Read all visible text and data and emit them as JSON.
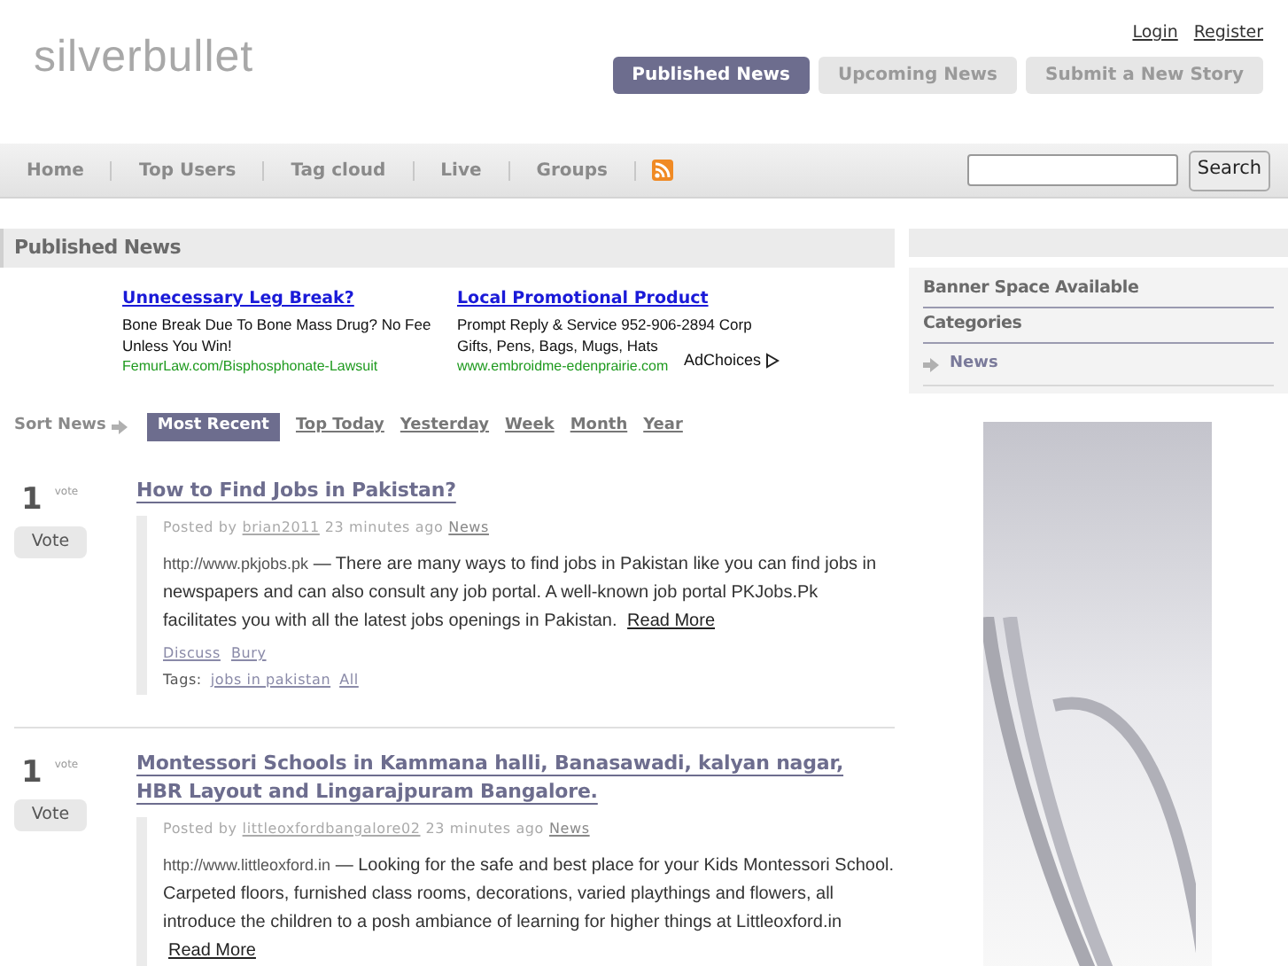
{
  "logo": "silverbullet",
  "user_links": [
    "Login",
    "Register"
  ],
  "tabs": [
    {
      "label": "Published News",
      "selected": true
    },
    {
      "label": "Upcoming News",
      "selected": false
    },
    {
      "label": "Submit a New Story",
      "selected": false
    }
  ],
  "nav": {
    "items": [
      "Home",
      "Top Users",
      "Tag cloud",
      "Live",
      "Groups"
    ],
    "search_button": "Search"
  },
  "main": {
    "title": "Published News",
    "ads": [
      {
        "title": "Unnecessary Leg Break?",
        "body": "Bone Break Due To Bone Mass Drug? No Fee Unless You Win!",
        "url": "FemurLaw.com/Bisphosphonate-Lawsuit"
      },
      {
        "title": "Local Promotional Product",
        "body": "Prompt Reply & Service 952-906-2894 Corp Gifts, Pens, Bags, Mugs, Hats",
        "url": "www.embroidme-edenprairie.com"
      }
    ],
    "ad_choices": "AdChoices",
    "sort": {
      "label": "Sort News",
      "options": [
        {
          "label": "Most Recent",
          "selected": true
        },
        {
          "label": "Top Today",
          "selected": false
        },
        {
          "label": "Yesterday",
          "selected": false
        },
        {
          "label": "Week",
          "selected": false
        },
        {
          "label": "Month",
          "selected": false
        },
        {
          "label": "Year",
          "selected": false
        }
      ]
    },
    "stories": [
      {
        "votes": "1",
        "vote_label": "vote",
        "vote_button": "Vote",
        "title": "How to Find Jobs in Pakistan?",
        "posted_by": "Posted by",
        "author": "brian2011",
        "time": "23 minutes ago",
        "category": "News",
        "url": "http://www.pkjobs.pk",
        "body": "— There are many ways to find jobs in Pakistan like you can find jobs in newspapers and can also consult any job portal. A well-known job portal PKJobs.Pk facilitates you with all the latest jobs openings in Pakistan.",
        "read_more": "Read More",
        "actions": [
          "Discuss",
          "Bury"
        ],
        "tags_label": "Tags:",
        "tags": [
          "jobs in pakistan",
          "All"
        ]
      },
      {
        "votes": "1",
        "vote_label": "vote",
        "vote_button": "Vote",
        "title": "Montessori Schools in Kammana halli, Banasawadi, kalyan nagar, HBR Layout and Lingarajpuram Bangalore.",
        "posted_by": "Posted by",
        "author": "littleoxfordbangalore02",
        "time": "23 minutes ago",
        "category": "News",
        "url": "http://www.littleoxford.in",
        "body": "— Looking for the safe and best place for your Kids Montessori School. Carpeted floors, furnished class rooms, decorations, varied playthings and flowers, all introduce the children to a posh ambiance of learning for higher things at Littleoxford.in",
        "read_more": "Read More"
      }
    ]
  },
  "sidebar": {
    "sections": [
      "Banner Space Available",
      "Categories"
    ],
    "categories": [
      "News"
    ]
  }
}
